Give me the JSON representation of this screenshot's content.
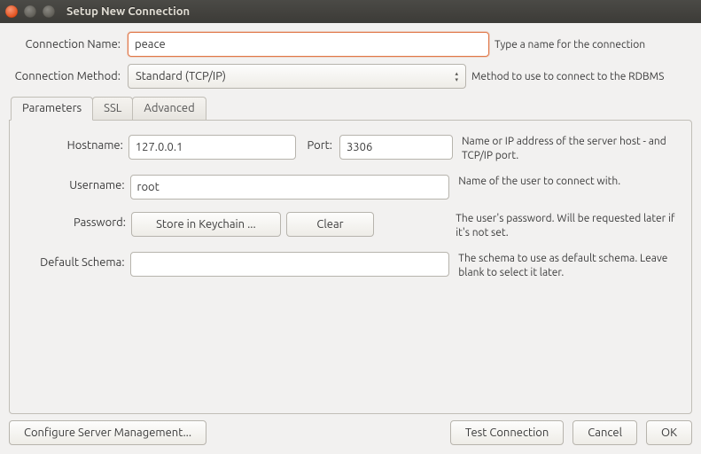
{
  "window": {
    "title": "Setup New Connection"
  },
  "form": {
    "conn_name_label": "Connection Name:",
    "conn_name_value": "peace",
    "conn_name_hint": "Type a name for the connection",
    "method_label": "Connection Method:",
    "method_value": "Standard (TCP/IP)",
    "method_hint": "Method to use to connect to the RDBMS"
  },
  "tabs": {
    "parameters": "Parameters",
    "ssl": "SSL",
    "advanced": "Advanced"
  },
  "params": {
    "hostname_label": "Hostname:",
    "hostname_value": "127.0.0.1",
    "port_label": "Port:",
    "port_value": "3306",
    "hostname_hint": "Name or IP address of the server host - and TCP/IP port.",
    "username_label": "Username:",
    "username_value": "root",
    "username_hint": "Name of the user to connect with.",
    "password_label": "Password:",
    "store_btn": "Store in Keychain ...",
    "clear_btn": "Clear",
    "password_hint": "The user's password. Will be requested later if it's not set.",
    "schema_label": "Default Schema:",
    "schema_value": "",
    "schema_hint": "The schema to use as default schema. Leave blank to select it later."
  },
  "footer": {
    "configure": "Configure Server Management...",
    "test": "Test Connection",
    "cancel": "Cancel",
    "ok": "OK"
  }
}
